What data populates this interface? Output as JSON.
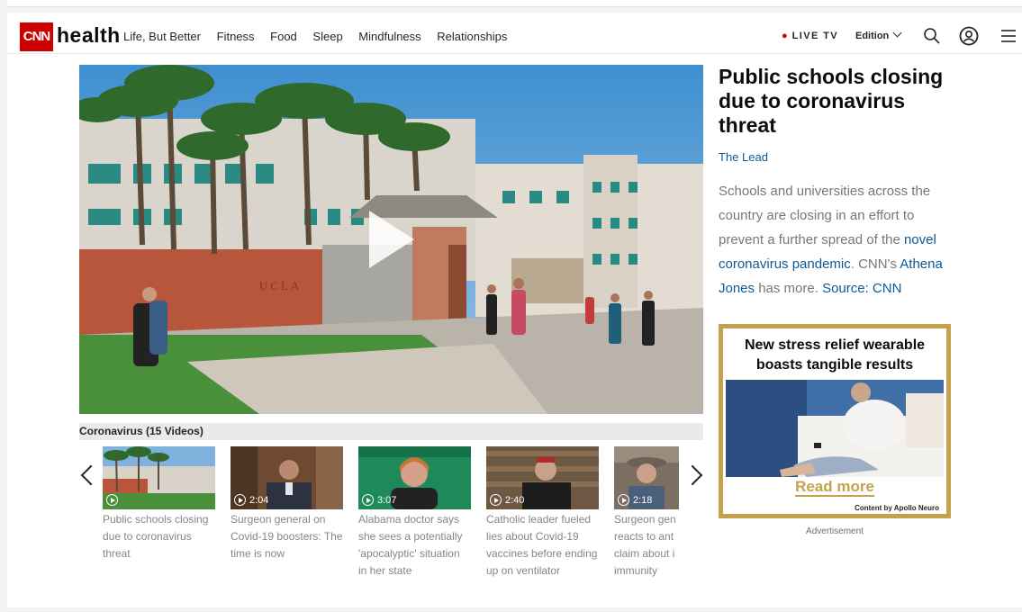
{
  "nav": {
    "logo_text": "CNN",
    "section": "health",
    "links": [
      "Life, But Better",
      "Fitness",
      "Food",
      "Sleep",
      "Mindfulness",
      "Relationships"
    ],
    "live_tv": "LIVE TV",
    "edition": "Edition",
    "icons": [
      "search-icon",
      "account-icon",
      "menu-icon"
    ]
  },
  "hero": {
    "headline": "Public schools closing due to coronavirus threat",
    "source_label": "The Lead",
    "description_pre": "Schools and universities across the country are closing in an effort to prevent a further spread of the ",
    "link1": "novel coronavirus pandemic",
    "description_mid": ". CNN's ",
    "link2": "Athena Jones",
    "description_post": " has more. ",
    "link3": "Source: CNN",
    "building_sign": "UCLA"
  },
  "playlist": {
    "title": "Coronavirus (15 Videos)",
    "videos": [
      {
        "caption": "Public schools closing due to coronavirus threat",
        "duration": ""
      },
      {
        "caption": "Surgeon general on Covid-19 boosters: The time is now",
        "duration": "2:04"
      },
      {
        "caption": "Alabama doctor says she sees a potentially 'apocalyptic' situation in her state",
        "duration": "3:07"
      },
      {
        "caption": "Catholic leader fueled lies about Covid-19 vaccines before ending up on ventilator",
        "duration": "2:40"
      },
      {
        "caption": "Surgeon gen reacts to ant claim about i immunity",
        "duration": "2:18"
      }
    ]
  },
  "ad": {
    "headline": "New stress relief wearable boasts tangible results",
    "cta": "Read more",
    "sponsor": "Content by Apollo Neuro",
    "label": "Advertisement"
  },
  "colors": {
    "cnn_red": "#cc0000",
    "link_blue": "#0c5a96",
    "ad_gold": "#c6a14d"
  }
}
